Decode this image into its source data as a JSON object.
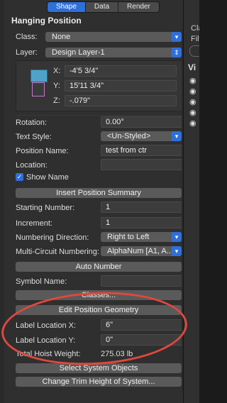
{
  "tabs": {
    "shape": "Shape",
    "data": "Data",
    "render": "Render"
  },
  "panel_title": "Hanging Position",
  "class": {
    "label": "Class:",
    "value": "None"
  },
  "layer": {
    "label": "Layer:",
    "value": "Design Layer-1"
  },
  "coords": {
    "x_label": "X:",
    "x_value": "-4'5 3/4\"",
    "y_label": "Y:",
    "y_value": "15'11 3/4\"",
    "z_label": "Z:",
    "z_value": "-.079\""
  },
  "rotation": {
    "label": "Rotation:",
    "value": "0.00°"
  },
  "text_style": {
    "label": "Text Style:",
    "value": "<Un-Styled>"
  },
  "position_name": {
    "label": "Position Name:",
    "value": "test from ctr"
  },
  "location": {
    "label": "Location:",
    "value": ""
  },
  "show_name": {
    "label": "Show Name",
    "checked": true
  },
  "buttons": {
    "insert_summary": "Insert Position Summary",
    "auto_number": "Auto Number",
    "classes": "Classes...",
    "edit_geometry": "Edit Position Geometry",
    "select_system": "Select System Objects",
    "change_trim": "Change Trim Height of System..."
  },
  "starting_number": {
    "label": "Starting Number:",
    "value": "1"
  },
  "increment": {
    "label": "Increment:",
    "value": "1"
  },
  "numbering_direction": {
    "label": "Numbering Direction:",
    "value": "Right to Left"
  },
  "multi_circuit": {
    "label": "Multi-Circuit Numbering:",
    "value": "AlphaNum [A1, A..."
  },
  "symbol_name": {
    "label": "Symbol Name:",
    "value": ""
  },
  "label_location_x": {
    "label": "Label Location X:",
    "value": "6\""
  },
  "label_location_y": {
    "label": "Label Location Y:",
    "value": "0\""
  },
  "total_weight": {
    "label": "Total Hoist Weight:",
    "value": "275.03 lb"
  },
  "right_pane": {
    "line1": "Cla",
    "line2": "Filt",
    "header": "Vi"
  },
  "accent_color": "#2f6fd8",
  "highlight_color": "#e0483e"
}
